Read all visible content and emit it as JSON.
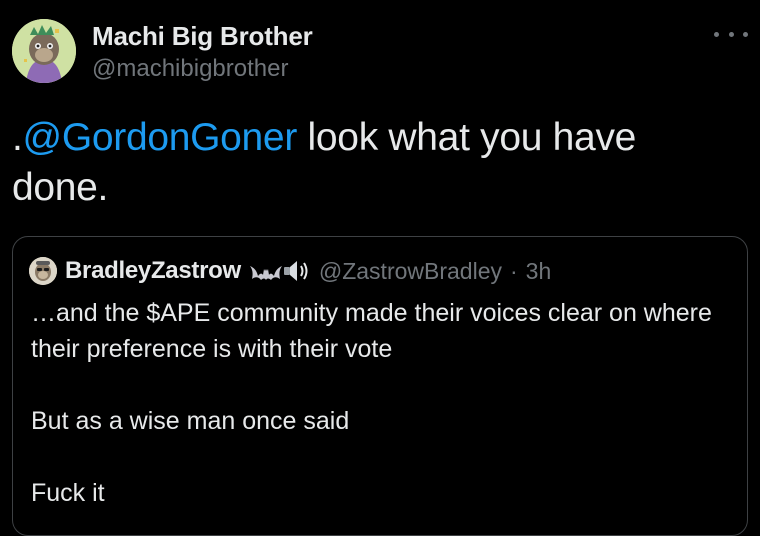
{
  "author": {
    "display_name": "Machi Big Brother",
    "handle": "@machibigbrother",
    "avatar_icon": "ape-avatar-icon"
  },
  "more_icon": "more-options-icon",
  "tweet": {
    "prefix": ".",
    "mention": "@GordonGoner",
    "text": " look what you have done."
  },
  "quoted_tweet": {
    "display_name": "BradleyZastrow",
    "emojis": [
      "bat-icon",
      "speaker-icon"
    ],
    "handle": "@ZastrowBradley",
    "separator": "·",
    "time": "3h",
    "lines": [
      "…and the $APE community made their voices clear on where their preference is with their vote",
      "But as a wise man once said",
      "Fuck it"
    ]
  },
  "colors": {
    "background": "#000000",
    "text": "#e7e9ea",
    "secondary": "#71767b",
    "link": "#1d9bf0",
    "border": "#3e4144"
  }
}
